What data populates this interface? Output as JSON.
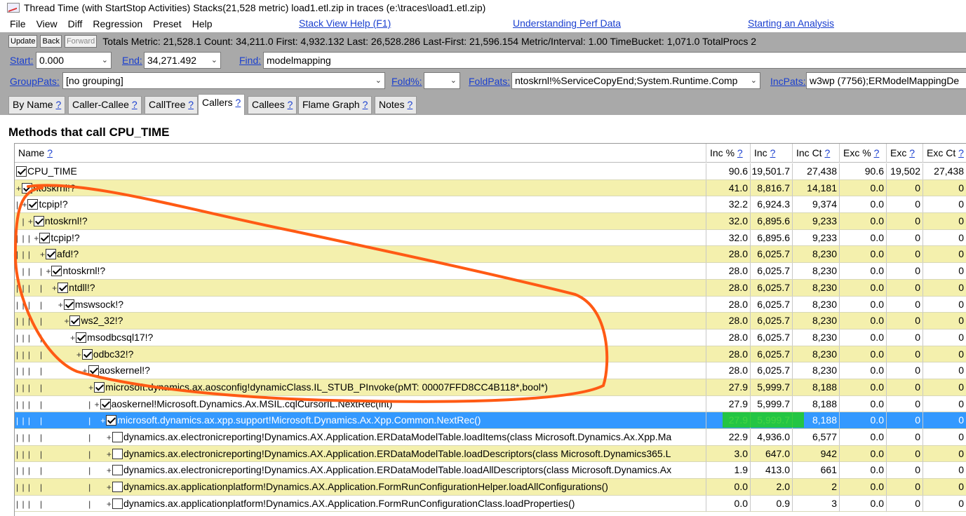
{
  "window": {
    "title": "Thread Time (with StartStop Activities) Stacks(21,528 metric) load1.etl.zip in traces (e:\\traces\\load1.etl.zip)"
  },
  "menu": {
    "items": [
      "File",
      "View",
      "Diff",
      "Regression",
      "Preset",
      "Help"
    ],
    "links": [
      "Stack View Help (F1)",
      "Understanding Perf Data",
      "Starting an Analysis"
    ]
  },
  "toolbar": {
    "update": "Update",
    "back": "Back",
    "forward": "Forward",
    "stats": "Totals Metric: 21,528.1  Count: 34,211.0  First: 4,932.132  Last: 26,528.286  Last-First: 21,596.154  Metric/Interval: 1.00  TimeBucket: 1,071.0  TotalProcs 2"
  },
  "filters": {
    "start_label": "Start:",
    "start_value": "0.000",
    "end_label": "End:",
    "end_value": "34,271.492",
    "find_label": "Find:",
    "find_value": "modelmapping",
    "grouppats_label": "GroupPats:",
    "grouppats_value": "[no grouping]",
    "fold_label": "Fold%:",
    "fold_value": "",
    "foldpats_label": "FoldPats:",
    "foldpats_value": "ntoskrnl!%ServiceCopyEnd;System.Runtime.Comp",
    "incpats_label": "IncPats:",
    "incpats_value": "w3wp (7756);ERModelMappingDe"
  },
  "tabs": [
    {
      "label": "By Name",
      "q": "?"
    },
    {
      "label": "Caller-Callee",
      "q": "?"
    },
    {
      "label": "CallTree",
      "q": "?"
    },
    {
      "label": "Callers",
      "q": "?"
    },
    {
      "label": "Callees",
      "q": "?"
    },
    {
      "label": "Flame Graph",
      "q": "?"
    },
    {
      "label": "Notes",
      "q": "?"
    }
  ],
  "heading": "Methods that call CPU_TIME",
  "columns": [
    {
      "label": "Name",
      "q": "?"
    },
    {
      "label": "Inc %",
      "q": "?"
    },
    {
      "label": "Inc",
      "q": "?"
    },
    {
      "label": "Inc Ct",
      "q": "?"
    },
    {
      "label": "Exc %",
      "q": "?"
    },
    {
      "label": "Exc",
      "q": "?"
    },
    {
      "label": "Exc Ct",
      "q": "?"
    }
  ],
  "rows": [
    {
      "tree": "",
      "checked": true,
      "name": "CPU_TIME",
      "inc_pct": "90.6",
      "inc": "19,501.7",
      "inc_ct": "27,438",
      "exc_pct": "90.6",
      "exc": "19,502",
      "exc_ct": "27,438"
    },
    {
      "tree": "+",
      "checked": true,
      "name": "ntoskrnl!?",
      "inc_pct": "41.0",
      "inc": "8,816.7",
      "inc_ct": "14,181",
      "exc_pct": "0.0",
      "exc": "0",
      "exc_ct": "0"
    },
    {
      "tree": "| +",
      "checked": true,
      "name": "tcpip!?",
      "inc_pct": "32.2",
      "inc": "6,924.3",
      "inc_ct": "9,374",
      "exc_pct": "0.0",
      "exc": "0",
      "exc_ct": "0"
    },
    {
      "tree": "| | +",
      "checked": true,
      "name": "ntoskrnl!?",
      "inc_pct": "32.0",
      "inc": "6,895.6",
      "inc_ct": "9,233",
      "exc_pct": "0.0",
      "exc": "0",
      "exc_ct": "0"
    },
    {
      "tree": "| | | +",
      "checked": true,
      "name": "tcpip!?",
      "inc_pct": "32.0",
      "inc": "6,895.6",
      "inc_ct": "9,233",
      "exc_pct": "0.0",
      "exc": "0",
      "exc_ct": "0"
    },
    {
      "tree": "| | |   +",
      "checked": true,
      "name": "afd!?",
      "inc_pct": "28.0",
      "inc": "6,025.7",
      "inc_ct": "8,230",
      "exc_pct": "0.0",
      "exc": "0",
      "exc_ct": "0"
    },
    {
      "tree": "| | |   | +",
      "checked": true,
      "name": "ntoskrnl!?",
      "inc_pct": "28.0",
      "inc": "6,025.7",
      "inc_ct": "8,230",
      "exc_pct": "0.0",
      "exc": "0",
      "exc_ct": "0"
    },
    {
      "tree": "| | |   |   +",
      "checked": true,
      "name": "ntdll!?",
      "inc_pct": "28.0",
      "inc": "6,025.7",
      "inc_ct": "8,230",
      "exc_pct": "0.0",
      "exc": "0",
      "exc_ct": "0"
    },
    {
      "tree": "| | |   |     +",
      "checked": true,
      "name": "mswsock!?",
      "inc_pct": "28.0",
      "inc": "6,025.7",
      "inc_ct": "8,230",
      "exc_pct": "0.0",
      "exc": "0",
      "exc_ct": "0"
    },
    {
      "tree": "| | |   |       +",
      "checked": true,
      "name": "ws2_32!?",
      "inc_pct": "28.0",
      "inc": "6,025.7",
      "inc_ct": "8,230",
      "exc_pct": "0.0",
      "exc": "0",
      "exc_ct": "0"
    },
    {
      "tree": "| | |   |         +",
      "checked": true,
      "name": "msodbcsql17!?",
      "inc_pct": "28.0",
      "inc": "6,025.7",
      "inc_ct": "8,230",
      "exc_pct": "0.0",
      "exc": "0",
      "exc_ct": "0"
    },
    {
      "tree": "| | |   |           +",
      "checked": true,
      "name": "odbc32!?",
      "inc_pct": "28.0",
      "inc": "6,025.7",
      "inc_ct": "8,230",
      "exc_pct": "0.0",
      "exc": "0",
      "exc_ct": "0"
    },
    {
      "tree": "| | |   |             +",
      "checked": true,
      "name": "aoskernel!?",
      "inc_pct": "28.0",
      "inc": "6,025.7",
      "inc_ct": "8,230",
      "exc_pct": "0.0",
      "exc": "0",
      "exc_ct": "0"
    },
    {
      "tree": "| | |   |               +",
      "checked": true,
      "name": "microsoft.dynamics.ax.aosconfig!dynamicClass.IL_STUB_PInvoke(pMT: 00007FFD8CC4B118*,bool*)",
      "inc_pct": "27.9",
      "inc": "5,999.7",
      "inc_ct": "8,188",
      "exc_pct": "0.0",
      "exc": "0",
      "exc_ct": "0"
    },
    {
      "tree": "| | |   |               | +",
      "checked": true,
      "name": "aoskernel!Microsoft.Dynamics.Ax.MSIL.cqlCursorIL.NextRec(int)",
      "inc_pct": "27.9",
      "inc": "5,999.7",
      "inc_ct": "8,188",
      "exc_pct": "0.0",
      "exc": "0",
      "exc_ct": "0"
    },
    {
      "tree": "| | |   |               |   +",
      "checked": true,
      "name": "microsoft.dynamics.ax.xpp.support!Microsoft.Dynamics.Ax.Xpp.Common.NextRec()",
      "inc_pct": "27.9",
      "inc": "5,999.7",
      "inc_ct": "8,188",
      "exc_pct": "0.0",
      "exc": "0",
      "exc_ct": "0"
    },
    {
      "tree": "| | |   |               |     +",
      "checked": false,
      "name": "dynamics.ax.electronicreporting!Dynamics.AX.Application.ERDataModelTable.loadItems(class Microsoft.Dynamics.Ax.Xpp.Ma",
      "inc_pct": "22.9",
      "inc": "4,936.0",
      "inc_ct": "6,577",
      "exc_pct": "0.0",
      "exc": "0",
      "exc_ct": "0"
    },
    {
      "tree": "| | |   |               |     +",
      "checked": false,
      "name": "dynamics.ax.electronicreporting!Dynamics.AX.Application.ERDataModelTable.loadDescriptors(class Microsoft.Dynamics365.L",
      "inc_pct": "3.0",
      "inc": "647.0",
      "inc_ct": "942",
      "exc_pct": "0.0",
      "exc": "0",
      "exc_ct": "0"
    },
    {
      "tree": "| | |   |               |     +",
      "checked": false,
      "name": "dynamics.ax.electronicreporting!Dynamics.AX.Application.ERDataModelTable.loadAllDescriptors(class Microsoft.Dynamics.Ax",
      "inc_pct": "1.9",
      "inc": "413.0",
      "inc_ct": "661",
      "exc_pct": "0.0",
      "exc": "0",
      "exc_ct": "0"
    },
    {
      "tree": "| | |   |               |     +",
      "checked": false,
      "name": "dynamics.ax.applicationplatform!Dynamics.AX.Application.FormRunConfigurationHelper.loadAllConfigurations()",
      "inc_pct": "0.0",
      "inc": "2.0",
      "inc_ct": "2",
      "exc_pct": "0.0",
      "exc": "0",
      "exc_ct": "0"
    },
    {
      "tree": "| | |   |               |     +",
      "checked": false,
      "name": "dynamics.ax.applicationplatform!Dynamics.AX.Application.FormRunConfigurationClass.loadProperties()",
      "inc_pct": "0.0",
      "inc": "0.9",
      "inc_ct": "3",
      "exc_pct": "0.0",
      "exc": "0",
      "exc_ct": "0"
    }
  ],
  "selected_row": 15,
  "colors": {
    "alt_row": "#f4f0ad",
    "selected": "#3399ff",
    "annotation": "#ff5a14",
    "highlight": "#22cc22"
  }
}
